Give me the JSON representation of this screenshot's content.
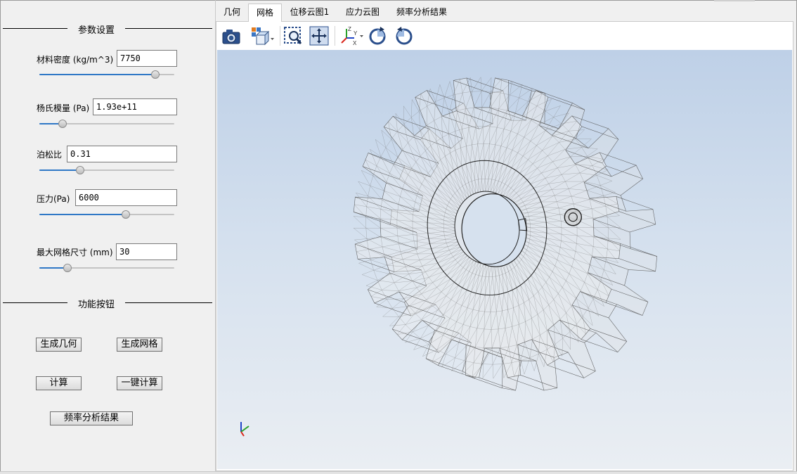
{
  "sections": {
    "params_title": "参数设置",
    "buttons_title": "功能按钮"
  },
  "params": {
    "density": {
      "label": "材料密度 (kg/m^3)",
      "value": "7750",
      "slider": 0.86
    },
    "youngs": {
      "label": "杨氏模量 (Pa)",
      "value": "1.93e+11",
      "slider": 0.17
    },
    "poisson": {
      "label": "泊松比",
      "value": "0.31",
      "slider": 0.3
    },
    "pressure": {
      "label": "压力(Pa)",
      "value": "6000",
      "slider": 0.64
    },
    "mesh_size": {
      "label": "最大网格尺寸 (mm)",
      "value": "30",
      "slider": 0.21
    }
  },
  "buttons": {
    "gen_geometry": "生成几何",
    "gen_mesh": "生成网格",
    "compute": "计算",
    "one_click": "一键计算",
    "freq_result": "频率分析结果"
  },
  "tabs": [
    "几何",
    "网格",
    "位移云图1",
    "应力云图",
    "频率分析结果"
  ],
  "active_tab": "网格",
  "toolbar_icons": [
    "camera-icon",
    "view-cube-icon",
    "zoom-box-icon",
    "pan-icon",
    "axes-orient-icon",
    "rotate-cw-icon",
    "rotate-ccw-icon"
  ],
  "colors": {
    "accent": "#2f78c6",
    "viewport_top": "#bed0e7",
    "viewport_bottom": "#eaeef3",
    "axis_x": "#d9261c",
    "axis_y": "#2aa12a",
    "axis_z": "#2146c7"
  }
}
